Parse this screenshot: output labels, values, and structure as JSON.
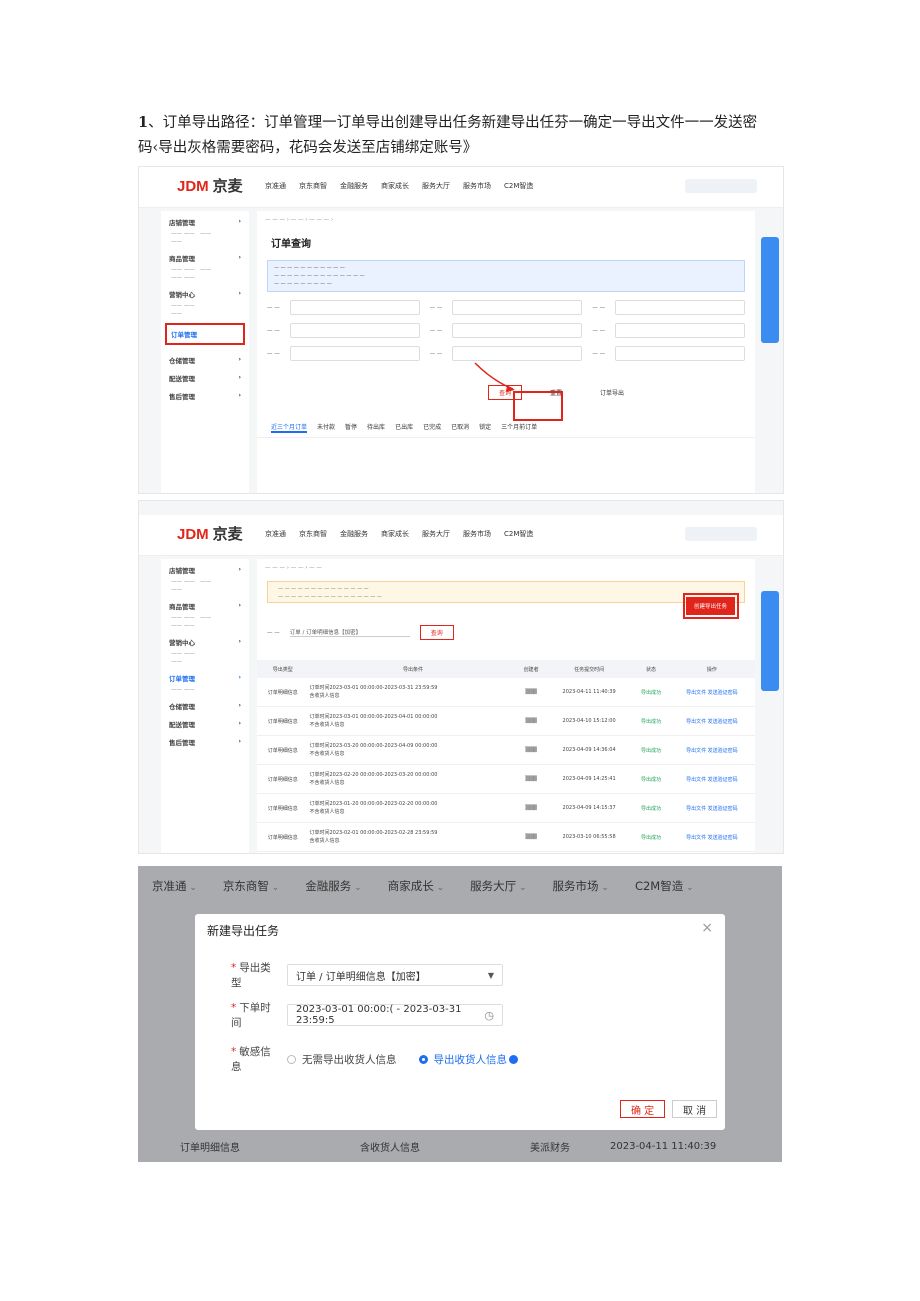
{
  "intro": {
    "num": "1",
    "text": "、订单导出路径：订单管理一订单导出创建导出任务新建导出任芬一确定一导出文件一一发送密码‹导出灰格需要密码，花码会发送至店铺绑定账号》"
  },
  "shot1": {
    "logo": "JDM",
    "logo_cn": "京麦",
    "nav": [
      "京准通",
      "京东商智",
      "金融服务",
      "商家成长",
      "服务大厅",
      "服务市场",
      "C2M智造"
    ],
    "sidebar": [
      "店铺管理",
      "商品管理",
      "营销中心",
      "订单管理",
      "仓储管理",
      "配送管理",
      "售后管理"
    ],
    "title": "订单查询",
    "tabs": [
      "近三个月订单",
      "未付款",
      "暂停",
      "待出库",
      "已出库",
      "已完成",
      "已取消",
      "锁定",
      "三个月前订单"
    ],
    "btn_query": "查询",
    "btn_reset": "重置",
    "btn_export": "订单导出"
  },
  "shot2": {
    "btn_create": "创建导出任务",
    "btn_query": "查询",
    "export_type": "订单 / 订单明细信息【加密】",
    "columns": [
      "导出类型",
      "导出条件",
      "创建者",
      "任务提交时间",
      "状态",
      "操作"
    ],
    "rows": [
      {
        "type": "订单明细信息",
        "cond": "订单时间2023-03-01 00:00:00-2023-03-31 23:59:59",
        "cond2": "含收货人信息",
        "time": "2023-04-11 11:40:39",
        "status": "导出成功",
        "op1": "导出文件",
        "op2": "发送验证密码"
      },
      {
        "type": "订单明细信息",
        "cond": "订单时间2023-03-01 00:00:00-2023-04-01 00:00:00",
        "cond2": "不含收货人信息",
        "time": "2023-04-10 15:12:00",
        "status": "导出成功",
        "op1": "导出文件",
        "op2": "发送验证密码"
      },
      {
        "type": "订单明细信息",
        "cond": "订单时间2023-03-20 00:00:00-2023-04-09 00:00:00",
        "cond2": "不含收货人信息",
        "time": "2023-04-09 14:36:04",
        "status": "导出成功",
        "op1": "导出文件",
        "op2": "发送验证密码"
      },
      {
        "type": "订单明细信息",
        "cond": "订单时间2023-02-20 00:00:00-2023-03-20 00:00:00",
        "cond2": "不含收货人信息",
        "time": "2023-04-09 14:25:41",
        "status": "导出成功",
        "op1": "导出文件",
        "op2": "发送验证密码"
      },
      {
        "type": "订单明细信息",
        "cond": "订单时间2023-01-20 00:00:00-2023-02-20 00:00:00",
        "cond2": "不含收货人信息",
        "time": "2023-04-09 14:15:37",
        "status": "导出成功",
        "op1": "导出文件",
        "op2": "发送验证密码"
      },
      {
        "type": "订单明细信息",
        "cond": "订单时间2023-02-01 00:00:00-2023-02-28 23:59:59",
        "cond2": "含收货人信息",
        "time": "2023-03-10 06:55:58",
        "status": "导出成功",
        "op1": "导出文件",
        "op2": "发送验证密码"
      }
    ]
  },
  "shot3": {
    "nav": [
      "京准通",
      "京东商智",
      "金融服务",
      "商家成长",
      "服务大厅",
      "服务市场",
      "C2M智造"
    ],
    "modal_title": "新建导出任务",
    "label_type": "导出类型",
    "value_type": "订单 / 订单明细信息【加密】",
    "label_time": "下单时间",
    "value_time": "2023-03-01 00:00:( - 2023-03-31 23:59:5",
    "label_sensitive": "敏感信息",
    "opt_no": "无需导出收货人信息",
    "opt_yes": "导出收货人信息",
    "btn_ok": "确 定",
    "btn_cancel": "取 消",
    "bg_row_type": "订单明细信息",
    "bg_row_cond": "含收货人信息",
    "bg_row_user": "美派财务",
    "bg_row_time": "2023-04-11 11:40:39"
  }
}
